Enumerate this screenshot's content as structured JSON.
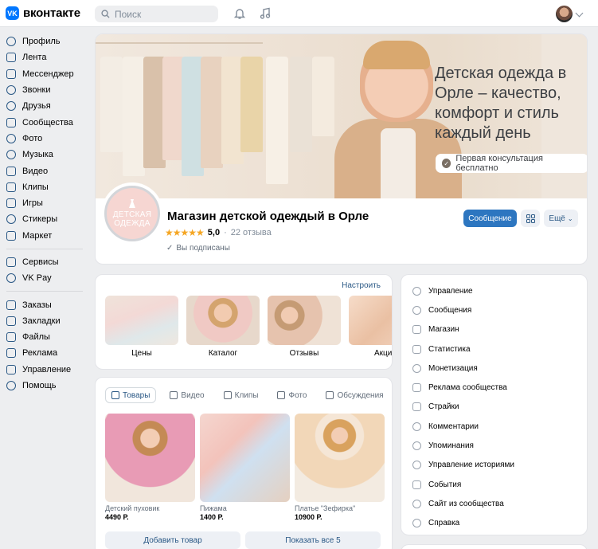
{
  "header": {
    "logo_text": "вконтакте",
    "logo_mark": "VK",
    "search_placeholder": "Поиск",
    "icons": [
      "bell-icon",
      "music-icon"
    ]
  },
  "sidebar": {
    "primary": [
      {
        "label": "Профиль",
        "icon": "profile-icon"
      },
      {
        "label": "Лента",
        "icon": "feed-icon"
      },
      {
        "label": "Мессенджер",
        "icon": "messenger-icon"
      },
      {
        "label": "Звонки",
        "icon": "phone-icon"
      },
      {
        "label": "Друзья",
        "icon": "friends-icon"
      },
      {
        "label": "Сообщества",
        "icon": "communities-icon"
      },
      {
        "label": "Фото",
        "icon": "photo-icon"
      },
      {
        "label": "Музыка",
        "icon": "music-icon"
      },
      {
        "label": "Видео",
        "icon": "video-icon"
      },
      {
        "label": "Клипы",
        "icon": "clips-icon"
      },
      {
        "label": "Игры",
        "icon": "games-icon"
      },
      {
        "label": "Стикеры",
        "icon": "stickers-icon"
      },
      {
        "label": "Маркет",
        "icon": "market-icon"
      }
    ],
    "secondary": [
      {
        "label": "Сервисы",
        "icon": "services-icon"
      },
      {
        "label": "VK Pay",
        "icon": "vkpay-icon"
      }
    ],
    "tertiary": [
      {
        "label": "Заказы",
        "icon": "orders-icon"
      },
      {
        "label": "Закладки",
        "icon": "bookmarks-icon"
      },
      {
        "label": "Файлы",
        "icon": "files-icon"
      },
      {
        "label": "Реклама",
        "icon": "ads-icon"
      },
      {
        "label": "Управление",
        "icon": "manage-icon"
      },
      {
        "label": "Помощь",
        "icon": "help-icon"
      }
    ]
  },
  "cover": {
    "title": "Детская одежда в Орле – качество, комфорт и стиль каждый день",
    "badge": "Первая консультация бесплатно"
  },
  "group": {
    "avatar_line1": "ДЕТСКАЯ",
    "avatar_line2": "ОДЕЖДА",
    "name": "Магазин детской одеждый в Орле",
    "stars": "★★★★★",
    "rating": "5,0",
    "separator": "·",
    "reviews": "22 отзыва",
    "subscribed": "Вы подписаны",
    "message_button": "Сообщение",
    "more_button": "Ещё"
  },
  "highlights": {
    "configure": "Настроить",
    "items": [
      {
        "label": "Цены"
      },
      {
        "label": "Каталог"
      },
      {
        "label": "Отзывы"
      },
      {
        "label": "Акции"
      }
    ]
  },
  "products": {
    "tabs": [
      {
        "label": "Товары",
        "active": true
      },
      {
        "label": "Видео"
      },
      {
        "label": "Клипы"
      },
      {
        "label": "Фото"
      },
      {
        "label": "Обсуждения"
      }
    ],
    "items": [
      {
        "name": "Детский пуховик",
        "price": "4490 Р."
      },
      {
        "name": "Пижама",
        "price": "1400 Р."
      },
      {
        "name": "Платье \"Зефирка\"",
        "price": "10900 Р."
      }
    ],
    "add_button": "Добавить товар",
    "show_all_button": "Показать все 5"
  },
  "management": {
    "items": [
      {
        "label": "Управление",
        "icon": "gear-icon"
      },
      {
        "label": "Сообщения",
        "icon": "message-icon"
      },
      {
        "label": "Магазин",
        "icon": "shop-bag-icon"
      },
      {
        "label": "Статистика",
        "icon": "stats-icon"
      },
      {
        "label": "Монетизация",
        "icon": "monetization-icon"
      },
      {
        "label": "Реклама сообщества",
        "icon": "megaphone-icon"
      },
      {
        "label": "Страйки",
        "icon": "strike-icon"
      },
      {
        "label": "Комментарии",
        "icon": "comment-icon"
      },
      {
        "label": "Упоминания",
        "icon": "mention-icon"
      },
      {
        "label": "Управление историями",
        "icon": "stories-icon"
      },
      {
        "label": "События",
        "icon": "events-icon"
      },
      {
        "label": "Сайт из сообщества",
        "icon": "globe-icon"
      },
      {
        "label": "Справка",
        "icon": "help-icon"
      }
    ]
  },
  "colors": {
    "accent": "#2d76c0",
    "link": "#2a5885",
    "page_bg": "#edeef0",
    "vk_blue": "#0077ff",
    "star": "#f5a623"
  }
}
